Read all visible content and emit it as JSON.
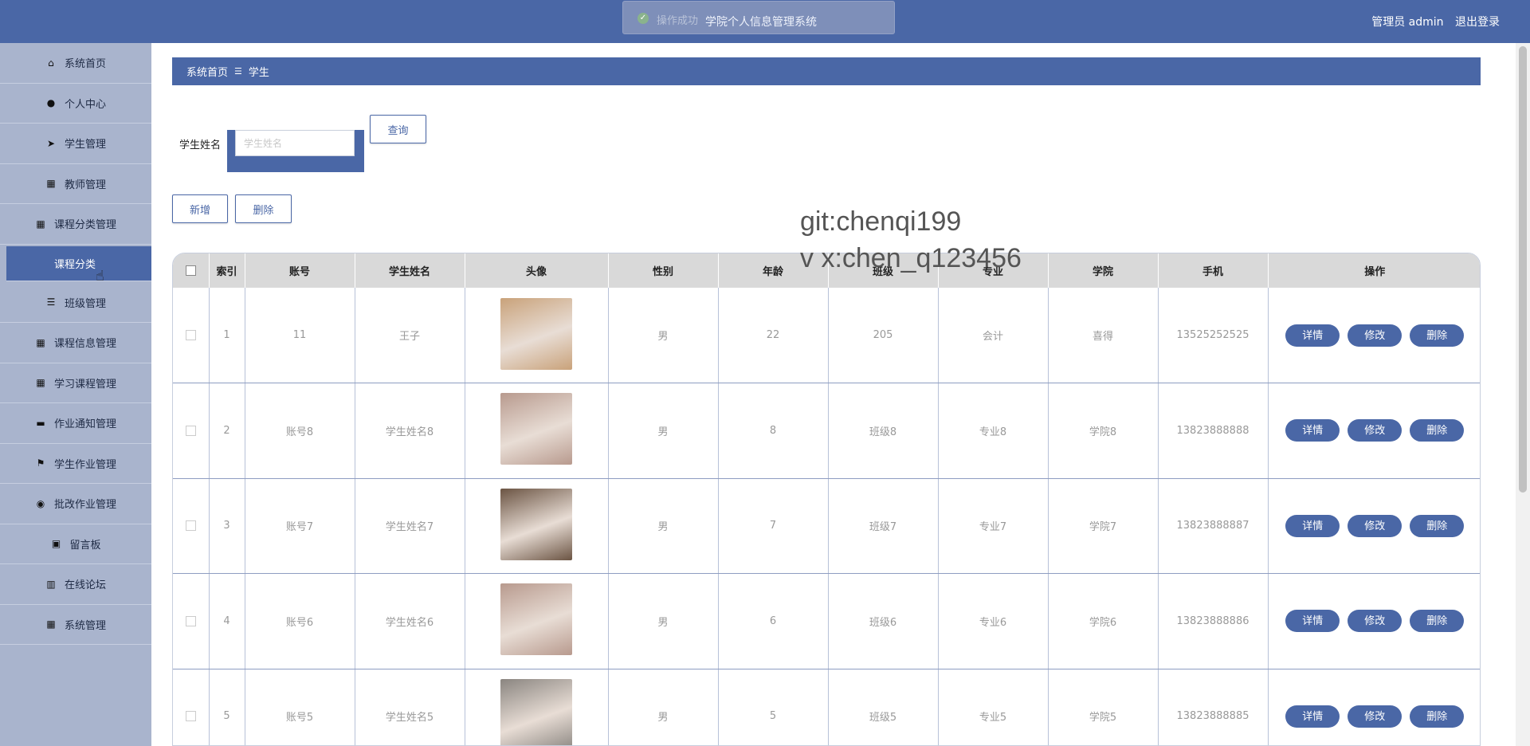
{
  "header": {
    "toast_message": "操作成功",
    "app_title": "学院个人信息管理系统",
    "user_label": "管理员 admin",
    "logout_label": "退出登录"
  },
  "sidebar": {
    "items": [
      {
        "label": "系统首页",
        "icon": "home-icon"
      },
      {
        "label": "个人中心",
        "icon": "user-icon"
      },
      {
        "label": "学生管理",
        "icon": "paper-plane-icon"
      },
      {
        "label": "教师管理",
        "icon": "grid-icon"
      },
      {
        "label": "课程分类管理",
        "icon": "grid-icon"
      },
      {
        "label": "课程分类",
        "icon": "",
        "sub": true
      },
      {
        "label": "班级管理",
        "icon": "list-icon"
      },
      {
        "label": "课程信息管理",
        "icon": "grid-icon"
      },
      {
        "label": "学习课程管理",
        "icon": "grid-icon"
      },
      {
        "label": "作业通知管理",
        "icon": "book-icon"
      },
      {
        "label": "学生作业管理",
        "icon": "flag-icon"
      },
      {
        "label": "批改作业管理",
        "icon": "pin-icon"
      },
      {
        "label": "留言板",
        "icon": "clipboard-icon"
      },
      {
        "label": "在线论坛",
        "icon": "books-icon"
      },
      {
        "label": "系统管理",
        "icon": "grid-icon"
      }
    ]
  },
  "breadcrumb": {
    "home": "系统首页",
    "separator": "☰",
    "current": "学生"
  },
  "search": {
    "label": "学生姓名",
    "placeholder": "学生姓名",
    "value": "",
    "query_label": "查询"
  },
  "actions": {
    "add_label": "新增",
    "delete_label": "删除"
  },
  "watermark": {
    "line1": "git:chenqi199",
    "line2": "v x:chen_q123456"
  },
  "table": {
    "columns": [
      "",
      "索引",
      "账号",
      "学生姓名",
      "头像",
      "性别",
      "年龄",
      "班级",
      "专业",
      "学院",
      "手机",
      "操作"
    ],
    "row_buttons": {
      "detail": "详情",
      "edit": "修改",
      "delete": "删除"
    },
    "rows": [
      {
        "index": "1",
        "account": "11",
        "name": "王子",
        "gender": "男",
        "age": "22",
        "class": "205",
        "major": "会计",
        "college": "喜得",
        "phone": "13525252525",
        "avatar_color": "#c9a27a"
      },
      {
        "index": "2",
        "account": "账号8",
        "name": "学生姓名8",
        "gender": "男",
        "age": "8",
        "class": "班级8",
        "major": "专业8",
        "college": "学院8",
        "phone": "13823888888",
        "avatar_color": "#b89a8e"
      },
      {
        "index": "3",
        "account": "账号7",
        "name": "学生姓名7",
        "gender": "男",
        "age": "7",
        "class": "班级7",
        "major": "专业7",
        "college": "学院7",
        "phone": "13823888887",
        "avatar_color": "#6b5443"
      },
      {
        "index": "4",
        "account": "账号6",
        "name": "学生姓名6",
        "gender": "男",
        "age": "6",
        "class": "班级6",
        "major": "专业6",
        "college": "学院6",
        "phone": "13823888886",
        "avatar_color": "#b89a8e"
      },
      {
        "index": "5",
        "account": "账号5",
        "name": "学生姓名5",
        "gender": "男",
        "age": "5",
        "class": "班级5",
        "major": "专业5",
        "college": "学院5",
        "phone": "13823888885",
        "avatar_color": "#8a8580"
      }
    ]
  },
  "colors": {
    "primary": "#4a67a6",
    "sidebar_bg": "#a9b4cd"
  }
}
